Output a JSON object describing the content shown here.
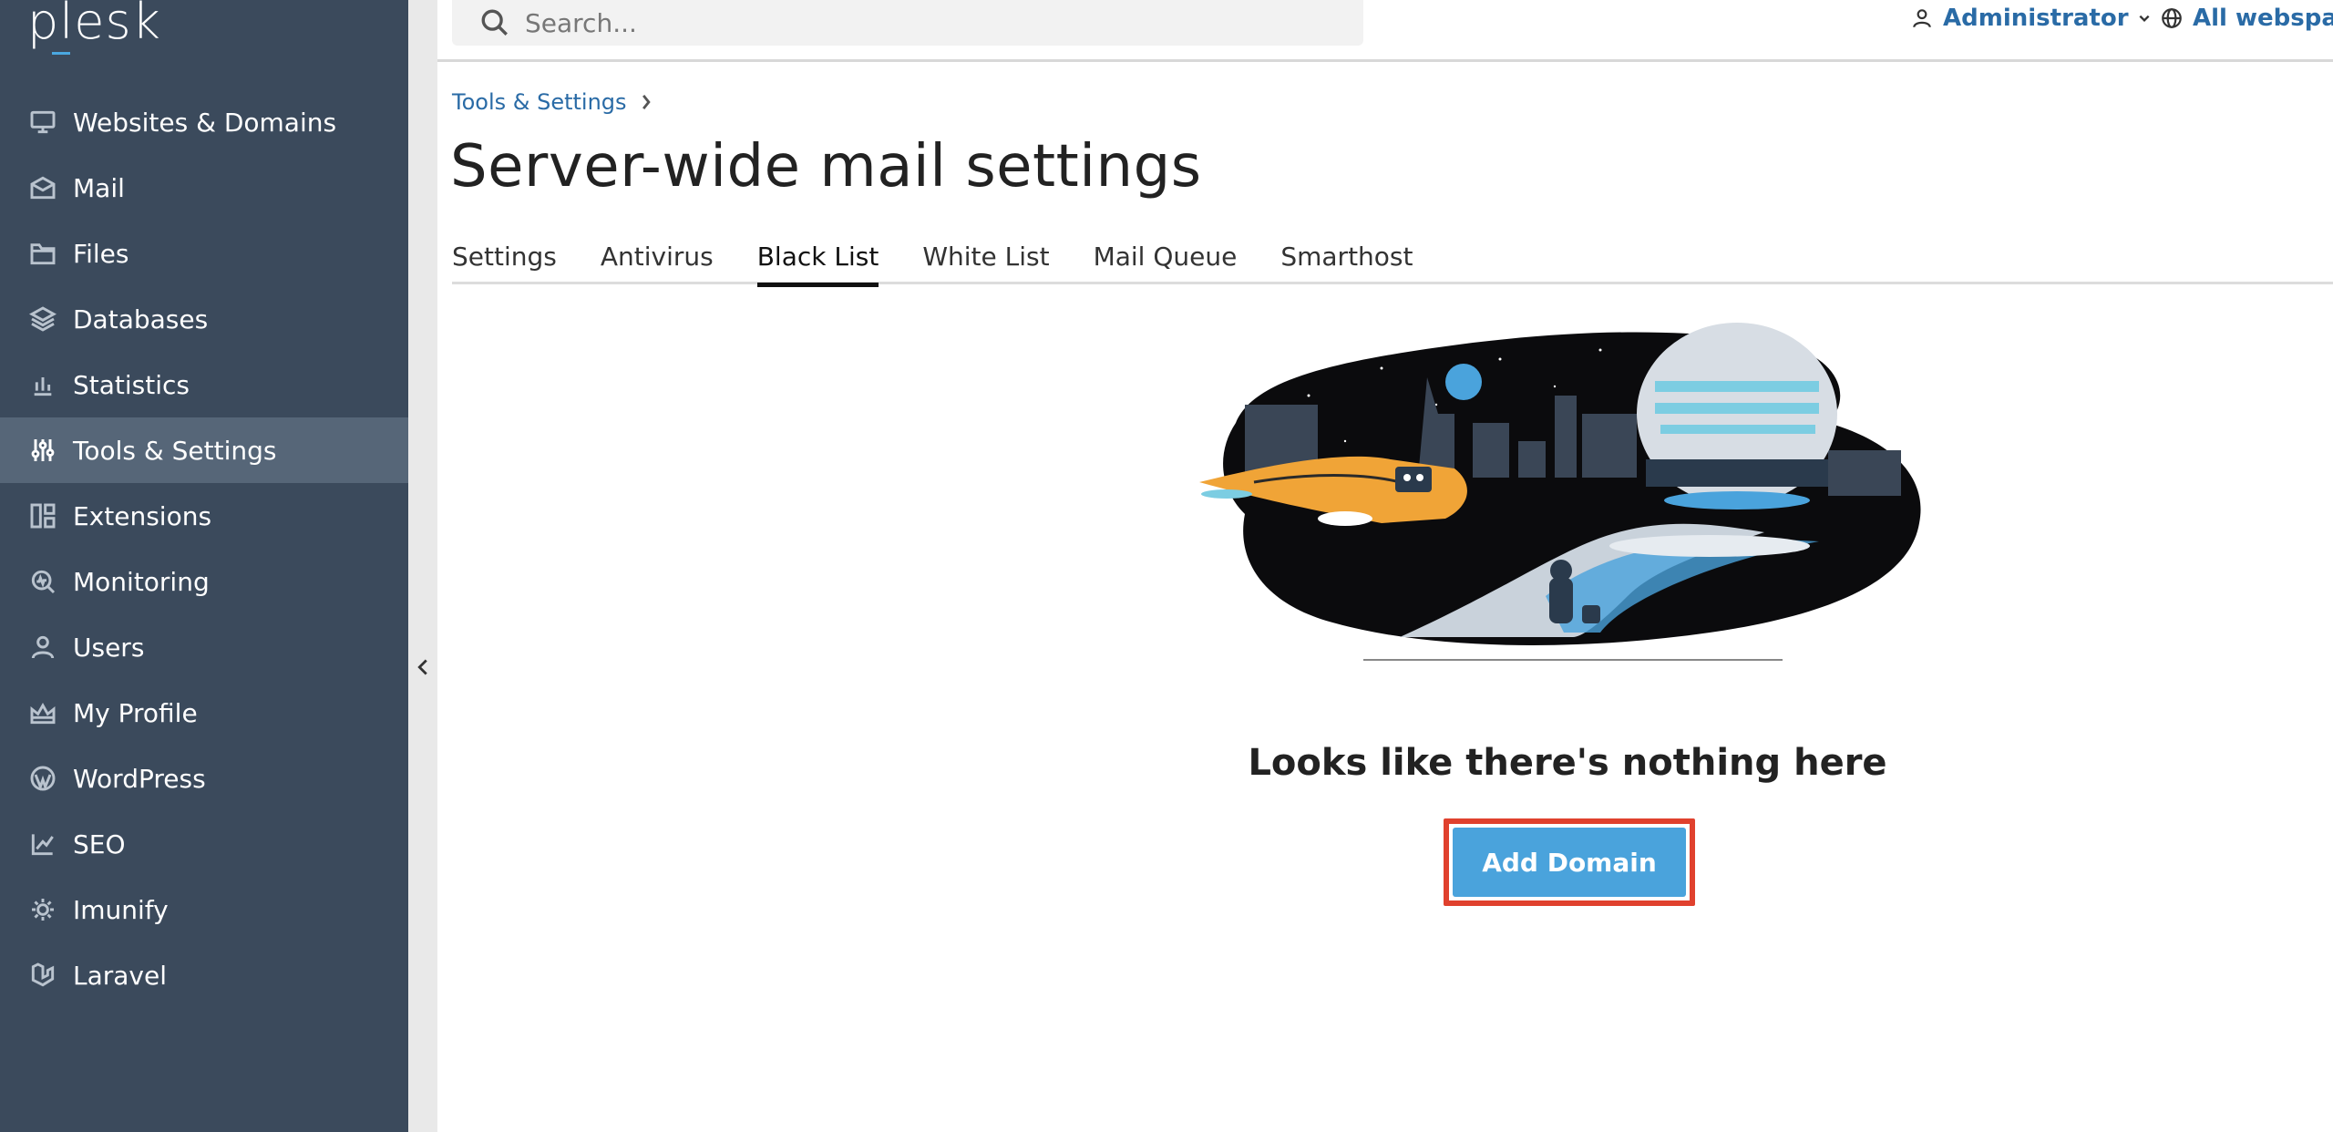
{
  "app": {
    "logo": "plesk"
  },
  "sidebar": {
    "items": [
      {
        "label": "Websites & Domains",
        "icon": "monitor-icon"
      },
      {
        "label": "Mail",
        "icon": "mail-icon"
      },
      {
        "label": "Files",
        "icon": "folder-icon"
      },
      {
        "label": "Databases",
        "icon": "database-icon"
      },
      {
        "label": "Statistics",
        "icon": "bar-chart-icon"
      },
      {
        "label": "Tools & Settings",
        "icon": "sliders-icon",
        "active": true
      },
      {
        "label": "Extensions",
        "icon": "extensions-icon"
      },
      {
        "label": "Monitoring",
        "icon": "monitoring-icon"
      },
      {
        "label": "Users",
        "icon": "user-icon"
      },
      {
        "label": "My Profile",
        "icon": "profile-icon"
      },
      {
        "label": "WordPress",
        "icon": "wordpress-icon"
      },
      {
        "label": "SEO",
        "icon": "seo-icon"
      },
      {
        "label": "Imunify",
        "icon": "imunify-icon"
      },
      {
        "label": "Laravel",
        "icon": "laravel-icon"
      }
    ]
  },
  "header": {
    "search_placeholder": "Search...",
    "user_label": "Administrator",
    "webspace_label": "All webspaces"
  },
  "breadcrumb": {
    "items": [
      "Tools & Settings"
    ]
  },
  "main": {
    "title": "Server-wide mail settings",
    "tabs": [
      {
        "label": "Settings"
      },
      {
        "label": "Antivirus"
      },
      {
        "label": "Black List",
        "active": true
      },
      {
        "label": "White List"
      },
      {
        "label": "Mail Queue"
      },
      {
        "label": "Smarthost"
      }
    ],
    "empty_state": {
      "title": "Looks like there's nothing here",
      "button_label": "Add Domain"
    }
  },
  "colors": {
    "sidebar_bg": "#3b4a5c",
    "sidebar_active": "#566678",
    "link": "#2a6ba6",
    "primary_button": "#4aa3dc",
    "highlight": "#e0412e"
  }
}
